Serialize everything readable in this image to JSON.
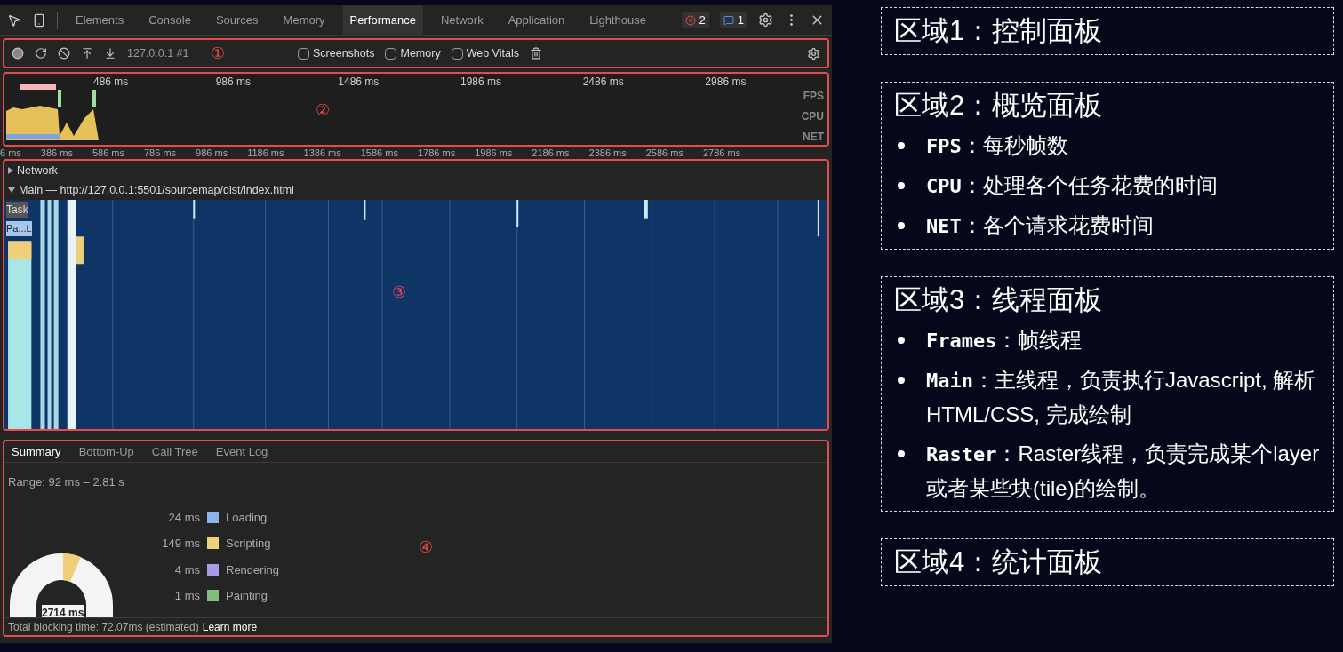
{
  "devtools": {
    "tabs": [
      {
        "label": "Elements",
        "selected": false
      },
      {
        "label": "Console",
        "selected": false
      },
      {
        "label": "Sources",
        "selected": false
      },
      {
        "label": "Memory",
        "selected": false
      },
      {
        "label": "Performance",
        "selected": true
      },
      {
        "label": "Network",
        "selected": false
      },
      {
        "label": "Application",
        "selected": false
      },
      {
        "label": "Lighthouse",
        "selected": false
      }
    ],
    "error_count": "2",
    "message_count": "1",
    "control_panel": {
      "marker": "①",
      "profile": "127.0.0.1 #1",
      "checkboxes": [
        {
          "label": "Screenshots",
          "checked": false
        },
        {
          "label": "Memory",
          "checked": false
        },
        {
          "label": "Web Vitals",
          "checked": false
        }
      ]
    },
    "overview": {
      "marker": "②",
      "ticks": [
        "486 ms",
        "986 ms",
        "1486 ms",
        "1986 ms",
        "2486 ms",
        "2986 ms"
      ],
      "lanes": [
        "FPS",
        "CPU",
        "NET"
      ]
    },
    "ruler": [
      "6 ms",
      "386 ms",
      "586 ms",
      "786 ms",
      "986 ms",
      "1186 ms",
      "1386 ms",
      "1586 ms",
      "1786 ms",
      "1986 ms",
      "2186 ms",
      "2386 ms",
      "2586 ms",
      "2786 ms"
    ],
    "threads": {
      "marker": "③",
      "tracks": [
        {
          "label": "Network",
          "expanded": false
        },
        {
          "label": "Main — http://127.0.0.1:5501/sourcemap/dist/index.html",
          "expanded": true
        }
      ],
      "task_label": "Task",
      "event_label": "Pa...L"
    },
    "summary": {
      "marker": "④",
      "tabs": [
        {
          "label": "Summary",
          "selected": true
        },
        {
          "label": "Bottom-Up",
          "selected": false
        },
        {
          "label": "Call Tree",
          "selected": false
        },
        {
          "label": "Event Log",
          "selected": false
        }
      ],
      "range": "Range: 92 ms – 2.81 s",
      "items": [
        {
          "time": "24 ms",
          "label": "Loading",
          "color": "#8cb4e8"
        },
        {
          "time": "149 ms",
          "label": "Scripting",
          "color": "#f0cf7a"
        },
        {
          "time": "4 ms",
          "label": "Rendering",
          "color": "#a99ae8"
        },
        {
          "time": "1 ms",
          "label": "Painting",
          "color": "#80c07c"
        }
      ],
      "total": "2714 ms",
      "blocking": "Total blocking time: 72.07ms (estimated)",
      "link": "Learn more"
    }
  },
  "notes": [
    {
      "title": "区域1：控制面板"
    },
    {
      "title": "区域2：概览面板",
      "bullets": [
        {
          "term": "FPS",
          "text": "：每秒帧数"
        },
        {
          "term": "CPU",
          "text": "：处理各个任务花费的时间"
        },
        {
          "term": "NET",
          "text": "：各个请求花费时间"
        }
      ]
    },
    {
      "title": "区域3：线程面板",
      "bullets": [
        {
          "term": "Frames",
          "text": "：帧线程"
        },
        {
          "term": "Main",
          "text": "：主线程，负责执行Javascript, 解析HTML/CSS, 完成绘制"
        },
        {
          "term": "Raster",
          "text": "：Raster线程，负责完成某个layer或者某些块(tile)的绘制。"
        }
      ]
    },
    {
      "title": "区域4：统计面板"
    }
  ]
}
